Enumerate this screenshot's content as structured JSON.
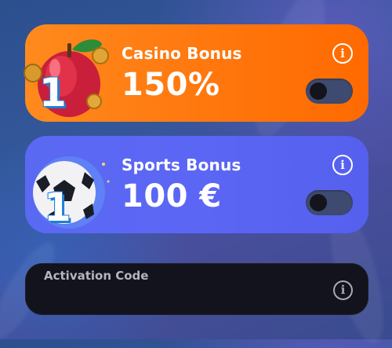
{
  "bonuses": [
    {
      "title": "Casino Bonus",
      "value": "150%",
      "badge_number": "1",
      "art_icon": "apple-coins-icon",
      "accent": "#ff7a10",
      "enabled": false
    },
    {
      "title": "Sports Bonus",
      "value": "100 €",
      "badge_number": "1",
      "art_icon": "soccer-ball-icon",
      "accent": "#5a66f2",
      "enabled": false
    }
  ],
  "activation": {
    "label": "Activation Code",
    "value": ""
  },
  "colors": {
    "toggle_track": "#3e4a6f",
    "toggle_knob": "#14141d",
    "code_card_bg": "#12131c"
  }
}
